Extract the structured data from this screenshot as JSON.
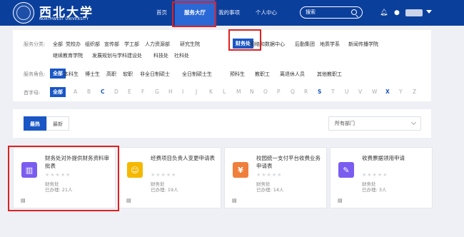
{
  "header": {
    "brand": "西北大学",
    "brand_en": "NORTHWEST UNIVERSITY",
    "nav": [
      "首页",
      "服务大厅",
      "我的事项",
      "个人中心"
    ],
    "search_placeholder": "搜索",
    "colors": {
      "bar": "#0b3f9c",
      "active": "#2a68d6",
      "highlight": "#e02020"
    }
  },
  "filter": {
    "category_label": "服务分类:",
    "categories_row1": [
      "全部",
      "党校办",
      "组织部",
      "宣传部",
      "学工部",
      "人力资源部",
      "研究生院",
      "财务处",
      "网络和数据中心",
      "后勤集团",
      "地质学系",
      "新闻传播学院"
    ],
    "categories_row2": [
      "继续教育学院",
      "发展规划与学科建设处",
      "科技处",
      "社科处"
    ],
    "selected_category": "财务处",
    "role_label": "服务角色:",
    "roles": [
      "全部",
      "本科生",
      "博士生",
      "高职",
      "软职",
      "非全日制硕士",
      "全日制硕士生",
      "预科生",
      "教职工",
      "离退休人员",
      "其他教职工"
    ],
    "letter_label": "首字母:",
    "letters_all": "全部",
    "letters": [
      "A",
      "B",
      "C",
      "D",
      "E",
      "F",
      "G",
      "H",
      "I",
      "J",
      "K",
      "L",
      "M",
      "N",
      "O",
      "P",
      "Q",
      "R",
      "S",
      "T",
      "U",
      "V",
      "W",
      "X",
      "Y",
      "Z"
    ]
  },
  "tabs": {
    "hot": "最热",
    "newest": "最新",
    "dept_select": "所有部门"
  },
  "cards": [
    {
      "title": "财务处对外提供财务资料审批表",
      "dept": "财务处",
      "count": "已办理: 21人",
      "icon": "building-icon",
      "color": "#7b5cf0"
    },
    {
      "title": "经费项目负责人变更申请表",
      "dept": "财务处",
      "count": "已办理: 19人",
      "icon": "person-icon",
      "color": "#f5b800"
    },
    {
      "title": "校园统一支付平台收费业务申请表",
      "dept": "财务处",
      "count": "已办理: 14人",
      "icon": "money-bag-icon",
      "color": "#f07f3c"
    },
    {
      "title": "收费票据领用申请",
      "dept": "财务处",
      "count": "已办理: 3人",
      "icon": "pen-icon",
      "color": "#7b5cf0"
    }
  ],
  "rating": "★★★★★",
  "card_footer_glyph": "▤"
}
